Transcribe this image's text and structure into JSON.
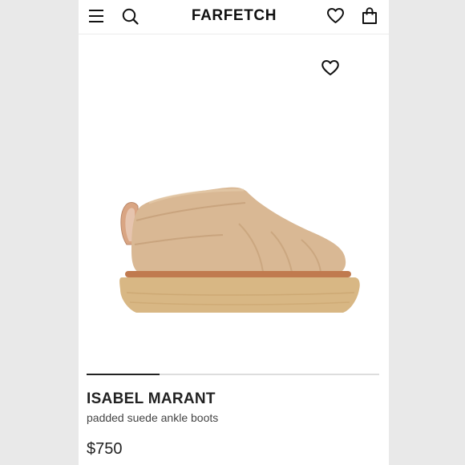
{
  "header": {
    "logo": "FARFETCH",
    "icons": [
      "menu-icon",
      "search-icon",
      "heart-icon",
      "shopping-bag-icon"
    ]
  },
  "product": {
    "image_alt": "padded suede ankle boot",
    "wishlist_icon": "heart-icon",
    "carousel": {
      "current": 1,
      "total": 4
    },
    "brand": "ISABEL MARANT",
    "description": "padded suede ankle boots",
    "price": "$750"
  },
  "colors": {
    "background": "#e9e9e9",
    "text": "#222222",
    "suede": "#d9b894",
    "sole": "#d8b784",
    "welt": "#c07a4f"
  }
}
